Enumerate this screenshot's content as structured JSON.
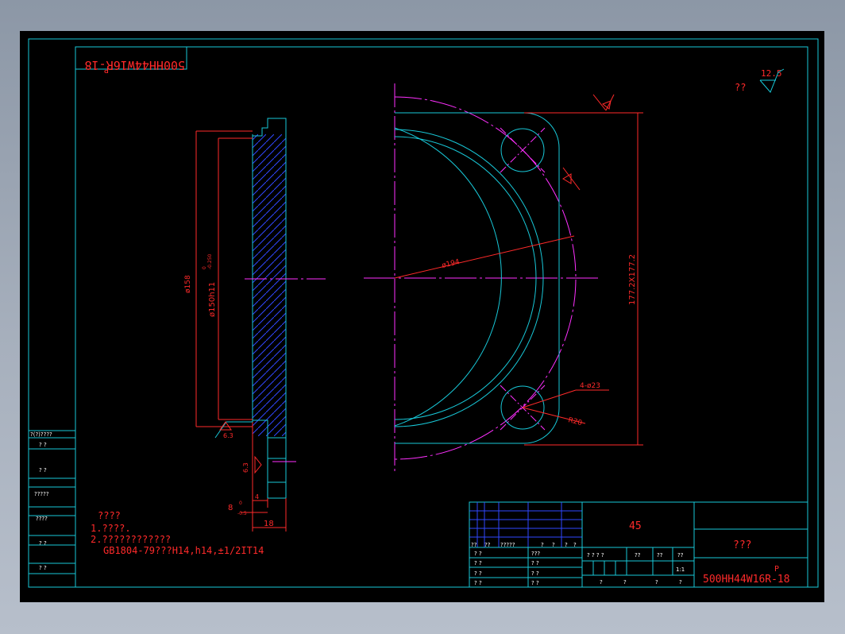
{
  "titlebox_mirrored": "500HH44W16R-18",
  "title_p": "P",
  "roughness": {
    "label": "??",
    "value": "12.5"
  },
  "dims": {
    "d158": "ø158",
    "d150": "ø150h11",
    "d150_upper": "0",
    "d150_lower": "-0.250",
    "d194": "ø194",
    "square": "177.2X177.2",
    "holes": "4-ø23",
    "r20": "R20",
    "w18": "18",
    "w4": "4",
    "w8": "8",
    "w8_tol_upper": "0",
    "w8_tol_lower": "-0.5",
    "rough_a": "6.3",
    "rough_b": "6.3"
  },
  "notes": {
    "heading": "????",
    "line1": "1.????.",
    "line2": "2.????????????",
    "line3": "GB1804-79???H14,h14,±1/2IT14"
  },
  "side_table": {
    "header": "?(?)????",
    "rows": [
      "?  ?",
      "?  ?",
      "?????",
      "????",
      "?  ?",
      "?  ?"
    ]
  },
  "title_block": {
    "material": "45",
    "part_name": "???",
    "drawing_no": "500HH44W16R-18",
    "drawing_p": "P",
    "scale": "1:1",
    "rev_row": [
      "??",
      "??",
      "?????",
      "?",
      "?",
      "?",
      "?"
    ],
    "left_labels": [
      "?  ?",
      "?  ?",
      "?  ?",
      "?  ?"
    ],
    "mid_labels": [
      "???",
      "?  ?",
      "?  ?",
      "?  ?"
    ],
    "stage_header": [
      "?  ?  ?  ?",
      "??",
      "??",
      "??"
    ],
    "bottom_row": [
      "?",
      "?",
      "?",
      "?"
    ]
  }
}
